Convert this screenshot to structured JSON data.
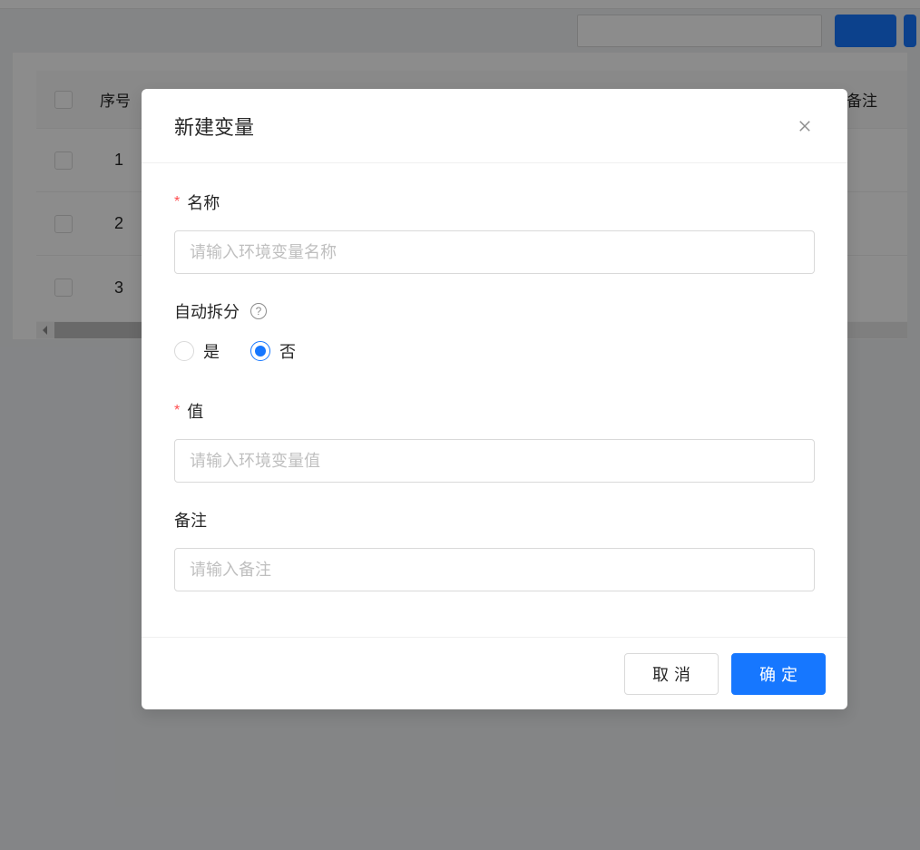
{
  "table": {
    "col_seq": "序号",
    "col_remark": "备注",
    "rows": [
      {
        "idx": "1"
      },
      {
        "idx": "2"
      },
      {
        "idx": "3"
      }
    ]
  },
  "modal": {
    "title": "新建变量",
    "fields": {
      "name": {
        "label": "名称",
        "placeholder": "请输入环境变量名称",
        "required": true
      },
      "autoSplit": {
        "label": "自动拆分",
        "options": {
          "yes": "是",
          "no": "否"
        },
        "selected": "no"
      },
      "value": {
        "label": "值",
        "placeholder": "请输入环境变量值",
        "required": true
      },
      "remark": {
        "label": "备注",
        "placeholder": "请输入备注",
        "required": false
      }
    },
    "buttons": {
      "cancel": "取消",
      "confirm": "确定"
    }
  }
}
